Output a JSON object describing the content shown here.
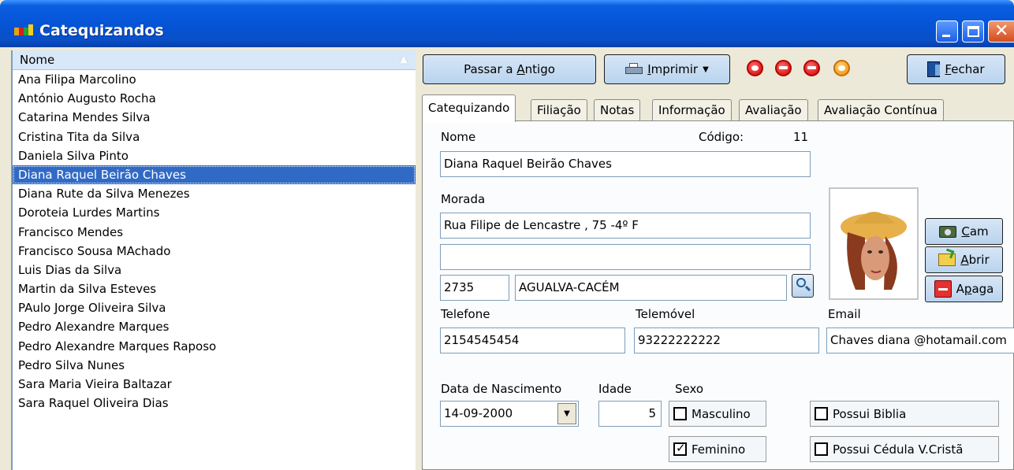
{
  "window": {
    "title": "Catequizandos",
    "controls": {
      "minimize": "minimize-icon",
      "maximize": "maximize-icon",
      "close": "close-icon"
    }
  },
  "list": {
    "header": "Nome",
    "items": [
      "Ana Filipa Marcolino",
      "António Augusto Rocha",
      "Catarina Mendes Silva",
      "Cristina Tita da Silva",
      "Daniela Silva Pinto",
      "Diana Raquel Beirão Chaves",
      "Diana Rute da Silva Menezes",
      "Doroteia Lurdes Martins",
      "Francisco Mendes",
      "Francisco Sousa MAchado",
      "Luis Dias da Silva",
      "Martin da Silva Esteves",
      "PAulo Jorge Oliveira Silva",
      "Pedro Alexandre Marques",
      "Pedro Alexandre Marques Raposo",
      "Pedro Silva Nunes",
      "Sara Maria Vieira Baltazar",
      "Sara Raquel Oliveira Dias"
    ],
    "selected": "Diana Raquel Beirão Chaves"
  },
  "toolbar": {
    "passar_pre": "Passar a ",
    "passar_u": "A",
    "passar_post": "ntigo",
    "imprimir_u": "I",
    "imprimir_post": "mprimir",
    "fechar_u": "F",
    "fechar_post": "echar"
  },
  "tabs": [
    "Catequizando",
    "Filiação",
    "Notas",
    "Informação",
    "Avaliação",
    "Avaliação Contínua"
  ],
  "form": {
    "nome_label": "Nome",
    "codigo_label": "Código:",
    "codigo_value": "11",
    "nome_value": "Diana Raquel Beirão Chaves",
    "morada_label": "Morada",
    "morada1": "Rua Filipe de Lencastre , 75 -4º F",
    "morada2": "",
    "cod_postal": "2735",
    "localidade": "AGUALVA-CACÉM",
    "telefone_label": "Telefone",
    "telefone_value": "2154545454",
    "telemovel_label": "Telemóvel",
    "telemovel_value": "93222222222",
    "email_label": "Email",
    "email_value": "Chaves diana @hotamail.com",
    "nascimento_label": "Data de Nascimento",
    "nascimento_value": "14-09-2000",
    "idade_label": "Idade",
    "idade_value": "5",
    "sexo_label": "Sexo",
    "masculino": "Masculino",
    "feminino": "Feminino",
    "masculino_checked": false,
    "feminino_checked": true,
    "possui_biblia": "Possui Biblia",
    "possui_cedula": "Possui Cédula V.Cristã"
  },
  "photo_buttons": {
    "cam_u": "C",
    "cam_post": "am",
    "abrir_u": "A",
    "abrir_post": "brir",
    "apaga_pre": "A",
    "apaga_u": "p",
    "apaga_post": "aga"
  },
  "colors": {
    "titlebar": "#0554d6",
    "selection": "#316ac5",
    "button": "#c8dcf2",
    "record_red": "#d00000",
    "record_orange": "#f28a00"
  }
}
